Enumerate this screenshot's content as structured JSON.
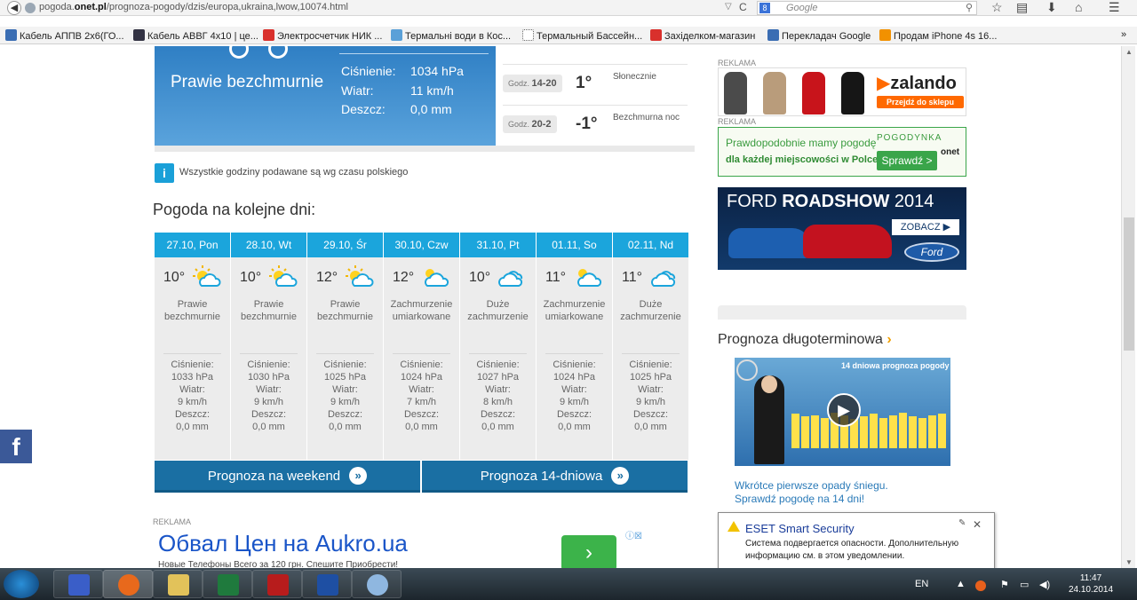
{
  "browser": {
    "url_host": "pogoda.",
    "url_domain": "onet.pl",
    "url_path": "/prognoza-pogody/dzis/europa,ukraina,lwow,10074.html",
    "search_placeholder": "Google",
    "bookmarks": [
      {
        "label": "Кабель АППВ 2х6(ГО...",
        "color": "#3a6db3"
      },
      {
        "label": "Кабель АВВГ 4х10 | це...",
        "color": "#334"
      },
      {
        "label": "Электросчетчик НИК ...",
        "color": "#d9302c"
      },
      {
        "label": "Термальні води в Кос...",
        "color": "#5aa0d8"
      },
      {
        "label": "Термальный Бассейн...",
        "color": "#ffffff"
      },
      {
        "label": "Західелком-магазин",
        "color": "#d9302c"
      },
      {
        "label": "Перекладач Google",
        "color": "#3a6db3"
      },
      {
        "label": "Продам iPhone 4s 16...",
        "color": "#f29100"
      }
    ]
  },
  "hero": {
    "condition": "Prawie bezchmurnie",
    "pressure_label": "Ciśnienie:",
    "pressure_value": "1034 hPa",
    "wind_label": "Wiatr:",
    "wind_value": "11 km/h",
    "rain_label": "Deszcz:",
    "rain_value": "0,0 mm"
  },
  "hourly": [
    {
      "prefix": "Godz.",
      "hours": "14-20",
      "temp": "1°",
      "desc": "Słonecznie"
    },
    {
      "prefix": "Godz.",
      "hours": "20-2",
      "temp": "-1°",
      "desc": "Bezchmurna noc"
    }
  ],
  "info_text": "Wszystkie godziny podawane są wg czasu polskiego",
  "next_days_title": "Pogoda na kolejne dni:",
  "days": [
    {
      "date": "27.10, Pon",
      "temp": "10°",
      "icon": "sun-cloud-icon",
      "cond": "Prawie bezchmurnie",
      "pressure": "1033 hPa",
      "wind": "9 km/h",
      "rain": "0,0 mm"
    },
    {
      "date": "28.10, Wt",
      "temp": "10°",
      "icon": "sun-cloud-icon",
      "cond": "Prawie bezchmurnie",
      "pressure": "1030 hPa",
      "wind": "9 km/h",
      "rain": "0,0 mm"
    },
    {
      "date": "29.10, Śr",
      "temp": "12°",
      "icon": "sun-cloud-icon",
      "cond": "Prawie bezchmurnie",
      "pressure": "1025 hPa",
      "wind": "9 km/h",
      "rain": "0,0 mm"
    },
    {
      "date": "30.10, Czw",
      "temp": "12°",
      "icon": "cloud-sun-icon",
      "cond": "Zachmurzenie umiarkowane",
      "pressure": "1024 hPa",
      "wind": "7 km/h",
      "rain": "0,0 mm"
    },
    {
      "date": "31.10, Pt",
      "temp": "10°",
      "icon": "clouds-icon",
      "cond": "Duże zachmurzenie",
      "pressure": "1027 hPa",
      "wind": "8 km/h",
      "rain": "0,0 mm"
    },
    {
      "date": "01.11, So",
      "temp": "11°",
      "icon": "cloud-sun-icon",
      "cond": "Zachmurzenie umiarkowane",
      "pressure": "1024 hPa",
      "wind": "9 km/h",
      "rain": "0,0 mm"
    },
    {
      "date": "02.11, Nd",
      "temp": "11°",
      "icon": "clouds-icon",
      "cond": "Duże zachmurzenie",
      "pressure": "1025 hPa",
      "wind": "9 km/h",
      "rain": "0,0 mm"
    }
  ],
  "stat_labels": {
    "pressure": "Ciśnienie:",
    "wind": "Wiatr:",
    "rain": "Deszcz:"
  },
  "buttons": {
    "weekend": "Prognoza na weekend",
    "fourteen": "Prognoza 14-dniowa"
  },
  "ad_bottom": {
    "label": "REKLAMA",
    "title": "Обвал Цен на Aukro.ua",
    "subtitle": "Новые Телефоны Всего за 120 грн. Спешите Приобрести!"
  },
  "right": {
    "reklama": "REKLAMA",
    "zalando_brand": "zalando",
    "zalando_cta": "Przejdź do sklepu",
    "pog_line1": "Prawdopodobnie mamy pogodę",
    "pog_line2": "dla każdej miejscowości w Polce!",
    "pog_brand": "POGODYNKA",
    "pog_btn": "Sprawdź >",
    "pog_onet": "onet",
    "ford_title_a": "FORD ",
    "ford_title_b": "ROADSHOW",
    "ford_year": " 2014",
    "ford_cta": "ZOBACZ ▶",
    "ford_logo": "Ford",
    "long_title": "Prognoza długoterminowa",
    "video_heading": "14 dniowa prognoza pogody",
    "video_caption_1": "Wkrótce pierwsze opady śniegu.",
    "video_caption_2": "Sprawdź pogodę na 14 dni!"
  },
  "eset": {
    "title": "ESET Smart Security",
    "message": "Система подвергается опасности. Дополнительную информацию см. в этом уведомлении."
  },
  "taskbar": {
    "lang": "EN",
    "time": "11:47",
    "date": "24.10.2014"
  }
}
